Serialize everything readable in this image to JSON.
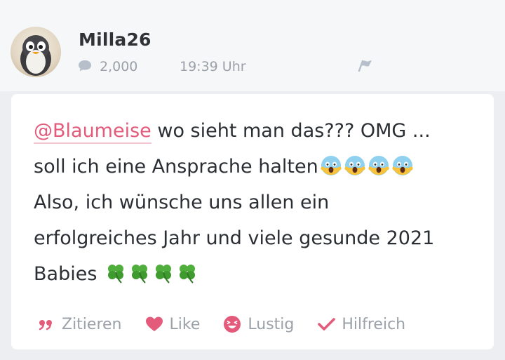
{
  "user": {
    "name": "Milla26",
    "post_count": "2,000",
    "time": "19:39 Uhr"
  },
  "post": {
    "mention": "@Blaumeise",
    "line1_rest": " wo sieht man das??? OMG ...",
    "line2": "soll ich eine Ansprache halten",
    "line3": "Also, ich wünsche uns allen ein",
    "line4": "erfolgreiches Jahr und viele gesunde 2021",
    "line5": "Babies ",
    "emoji_scream": "screaming-face-emoji",
    "emoji_clover": "four-leaf-clover-emoji"
  },
  "actions": {
    "quote": "Zitieren",
    "like": "Like",
    "funny": "Lustig",
    "helpful": "Hilfreich"
  },
  "colors": {
    "accent": "#e35a7a",
    "muted": "#9aa1a9",
    "text": "#2b2f34"
  }
}
